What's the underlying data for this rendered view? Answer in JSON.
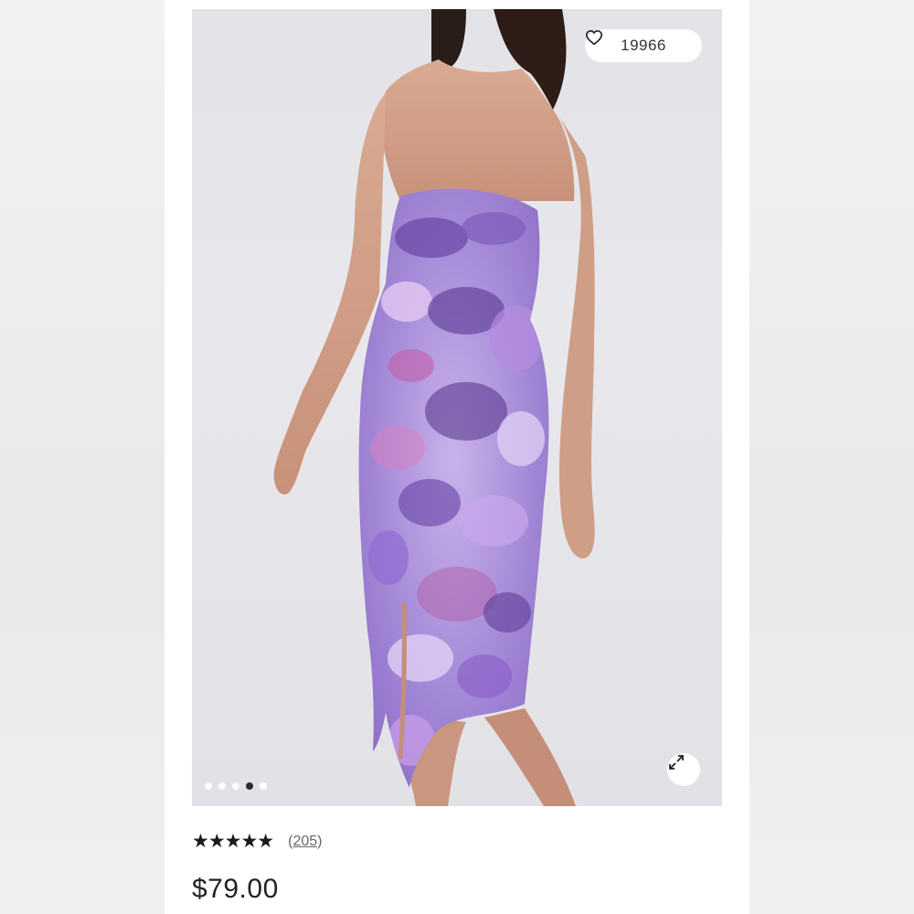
{
  "product": {
    "like_count": "19966",
    "rating_stars": "★★★★★",
    "review_count": "(205)",
    "price": "$79.00"
  },
  "gallery": {
    "total_images": 5,
    "active_index": 4
  },
  "icons": {
    "like": "heart-icon",
    "expand": "expand-icon"
  },
  "colors": {
    "dress_primary": "#9a7bd0",
    "dress_accent": "#c05aa6",
    "dress_dark": "#5a3d8c",
    "background": "#ffffff"
  }
}
